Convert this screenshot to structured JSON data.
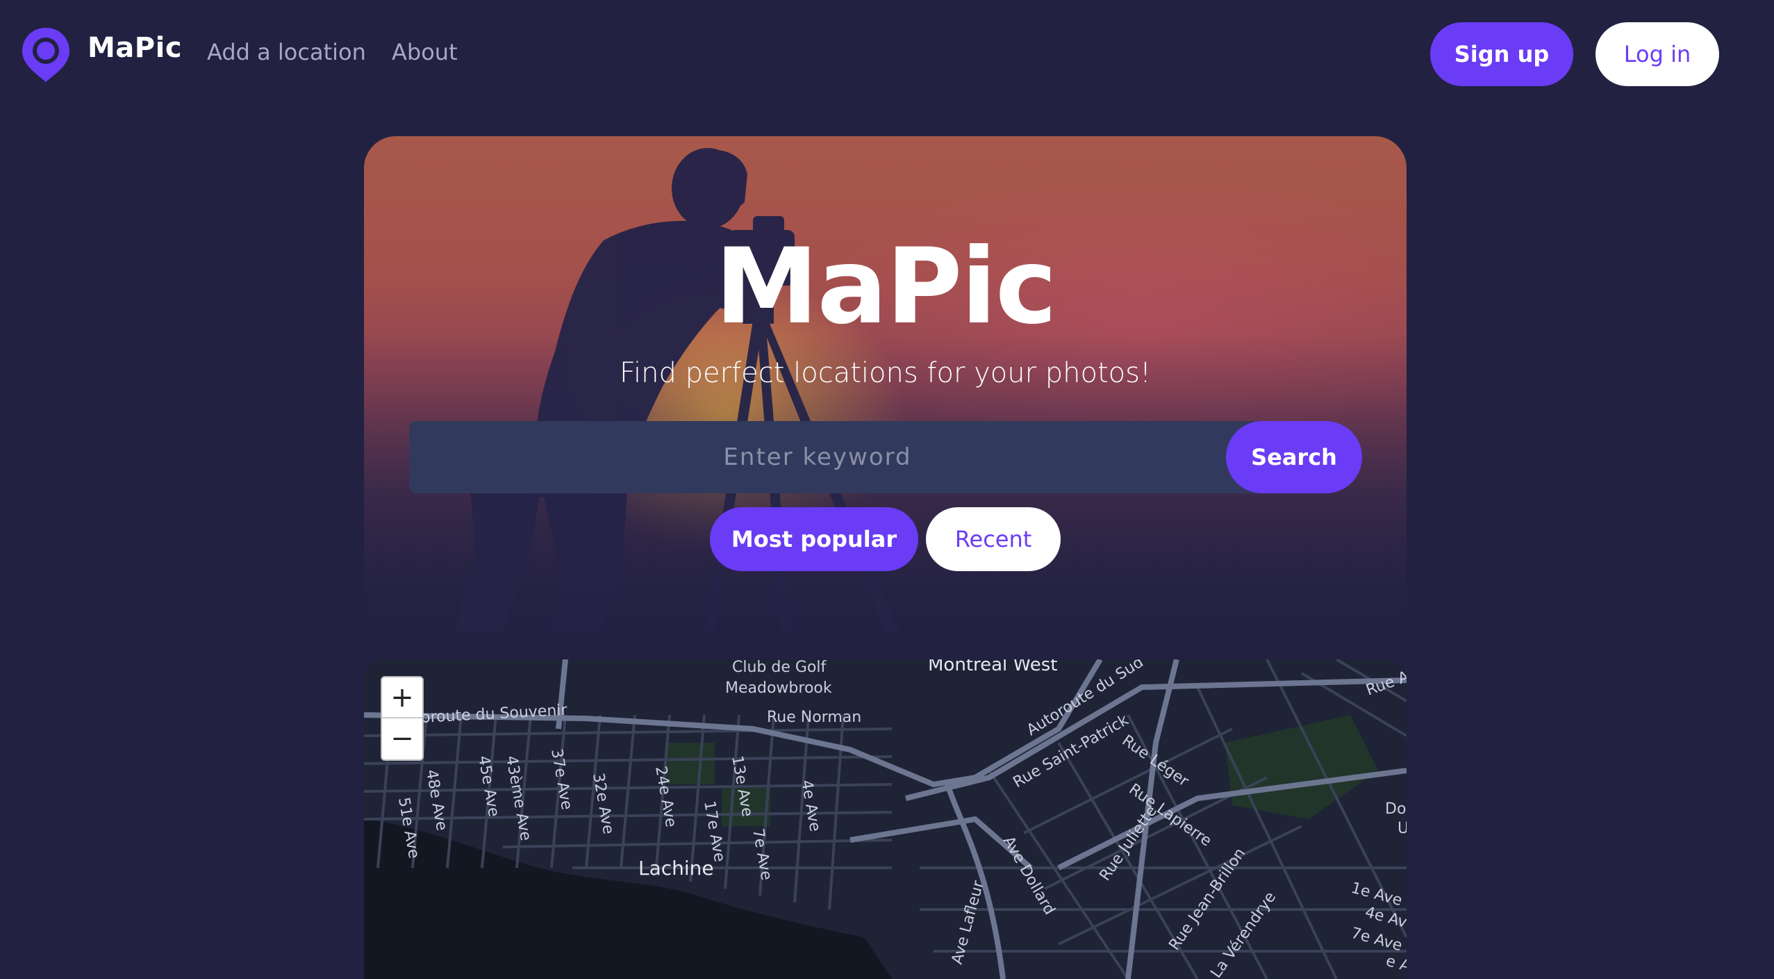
{
  "nav": {
    "brand": "MaPic",
    "links": [
      "Add a location",
      "About"
    ],
    "signup_label": "Sign up",
    "login_label": "Log in"
  },
  "hero": {
    "title": "MaPic",
    "subtitle": "Find perfect locations for your photos!",
    "search_placeholder": "Enter keyword",
    "search_value": "",
    "search_button": "Search",
    "filters": [
      "Most popular",
      "Recent"
    ]
  },
  "map": {
    "zoom_in": "+",
    "zoom_out": "−",
    "labels": {
      "golf": [
        "Club de Golf",
        "Meadowbrook"
      ],
      "montreal_west": "Montreal West",
      "autoroute_souvenir": "utoroute du Souvenir",
      "autoroute_sud": "Autoroute du Sud",
      "rue_norman": "Rue Norman",
      "rue_saint_patrick": "Rue Saint-Patrick",
      "rue_leger": "Rue Léger",
      "rue_lapierre": "Rue Lapierre",
      "rue_juliette": "Rue Juliette",
      "rue_jean_brillon": "Rue Jean-Brillon",
      "la_verendrye": "La Vérendrye",
      "ave_dollard": "Ave Dollard",
      "ave_lafleur": "Ave Lafleur",
      "lachine": "Lachine",
      "rue_a": "Rue A",
      "dou": "Dou",
      "u": "U",
      "avenues": [
        "51e Ave",
        "48e Ave",
        "45e Ave",
        "43ème Ave",
        "37e Ave",
        "32e Ave",
        "24e Ave",
        "17e Ave",
        "13e Ave",
        "7e Ave",
        "4e Ave",
        "1e Ave",
        "4e Ave",
        "7e Ave",
        "e Ave"
      ]
    }
  },
  "colors": {
    "background": "#222142",
    "accent": "#6a3cf5",
    "map_background": "#1e2336"
  },
  "icons": {
    "logo": "map-pin-icon"
  }
}
